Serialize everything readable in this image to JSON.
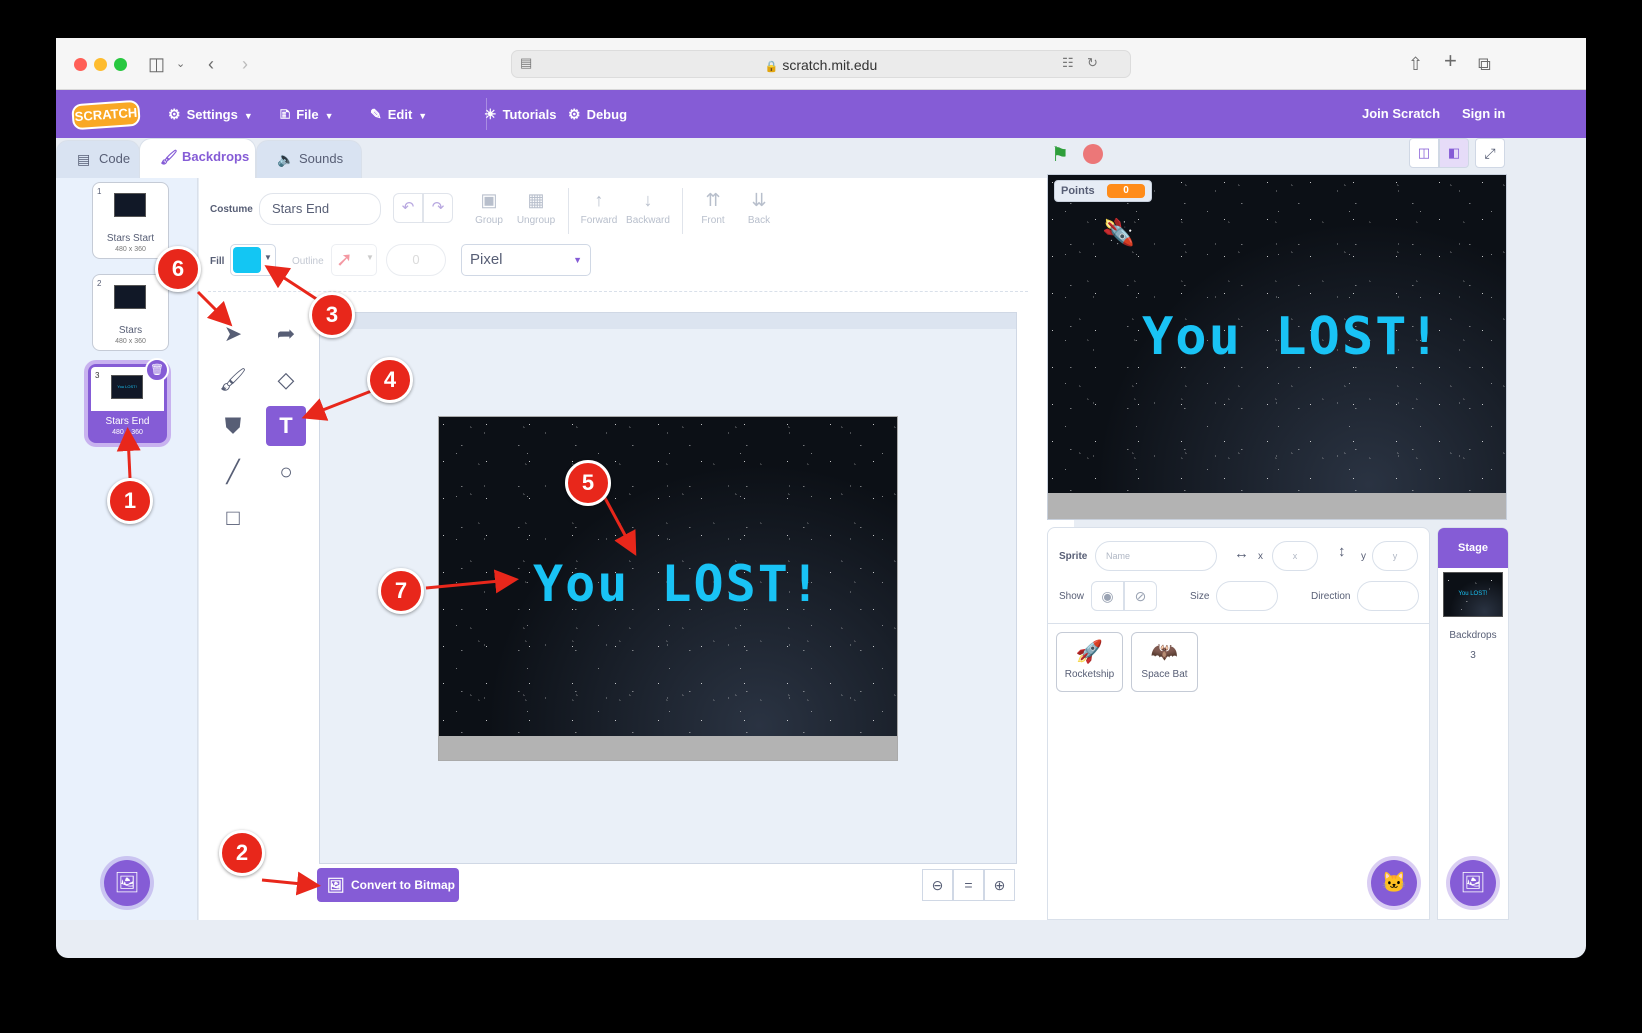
{
  "browser": {
    "url": "scratch.mit.edu"
  },
  "menubar": {
    "settings": "Settings",
    "file": "File",
    "edit": "Edit",
    "tutorials": "Tutorials",
    "debug": "Debug",
    "join": "Join Scratch",
    "signin": "Sign in"
  },
  "tabs": {
    "code": "Code",
    "backdrops": "Backdrops",
    "sounds": "Sounds"
  },
  "costumes": [
    {
      "num": "1",
      "name": "Stars Start",
      "size": "480 x 360"
    },
    {
      "num": "2",
      "name": "Stars",
      "size": "480 x 360"
    },
    {
      "num": "3",
      "name": "Stars End",
      "size": "480 x 360",
      "thumb_text": "You LOST!"
    }
  ],
  "editor": {
    "costume_label": "Costume",
    "costume_name": "Stars End",
    "group": "Group",
    "ungroup": "Ungroup",
    "forward": "Forward",
    "backward": "Backward",
    "front": "Front",
    "back": "Back",
    "fill_label": "Fill",
    "fill_color": "#13c6f3",
    "outline_label": "Outline",
    "outline_width": "0",
    "font": "Pixel",
    "canvas_text": "You LOST!",
    "convert_button": "Convert to Bitmap"
  },
  "stage": {
    "monitor_label": "Points",
    "monitor_value": "0",
    "text": "You LOST!"
  },
  "sprite_info": {
    "sprite_label": "Sprite",
    "name_placeholder": "Name",
    "x_label": "x",
    "x_placeholder": "x",
    "y_label": "y",
    "y_placeholder": "y",
    "show_label": "Show",
    "size_label": "Size",
    "direction_label": "Direction"
  },
  "sprites": [
    {
      "name": "Rocketship"
    },
    {
      "name": "Space Bat"
    }
  ],
  "stage_pane": {
    "header": "Stage",
    "thumb_text": "You LOST!",
    "backdrops_label": "Backdrops",
    "backdrops_count": "3"
  },
  "annotations": [
    "1",
    "2",
    "3",
    "4",
    "5",
    "6",
    "7"
  ]
}
